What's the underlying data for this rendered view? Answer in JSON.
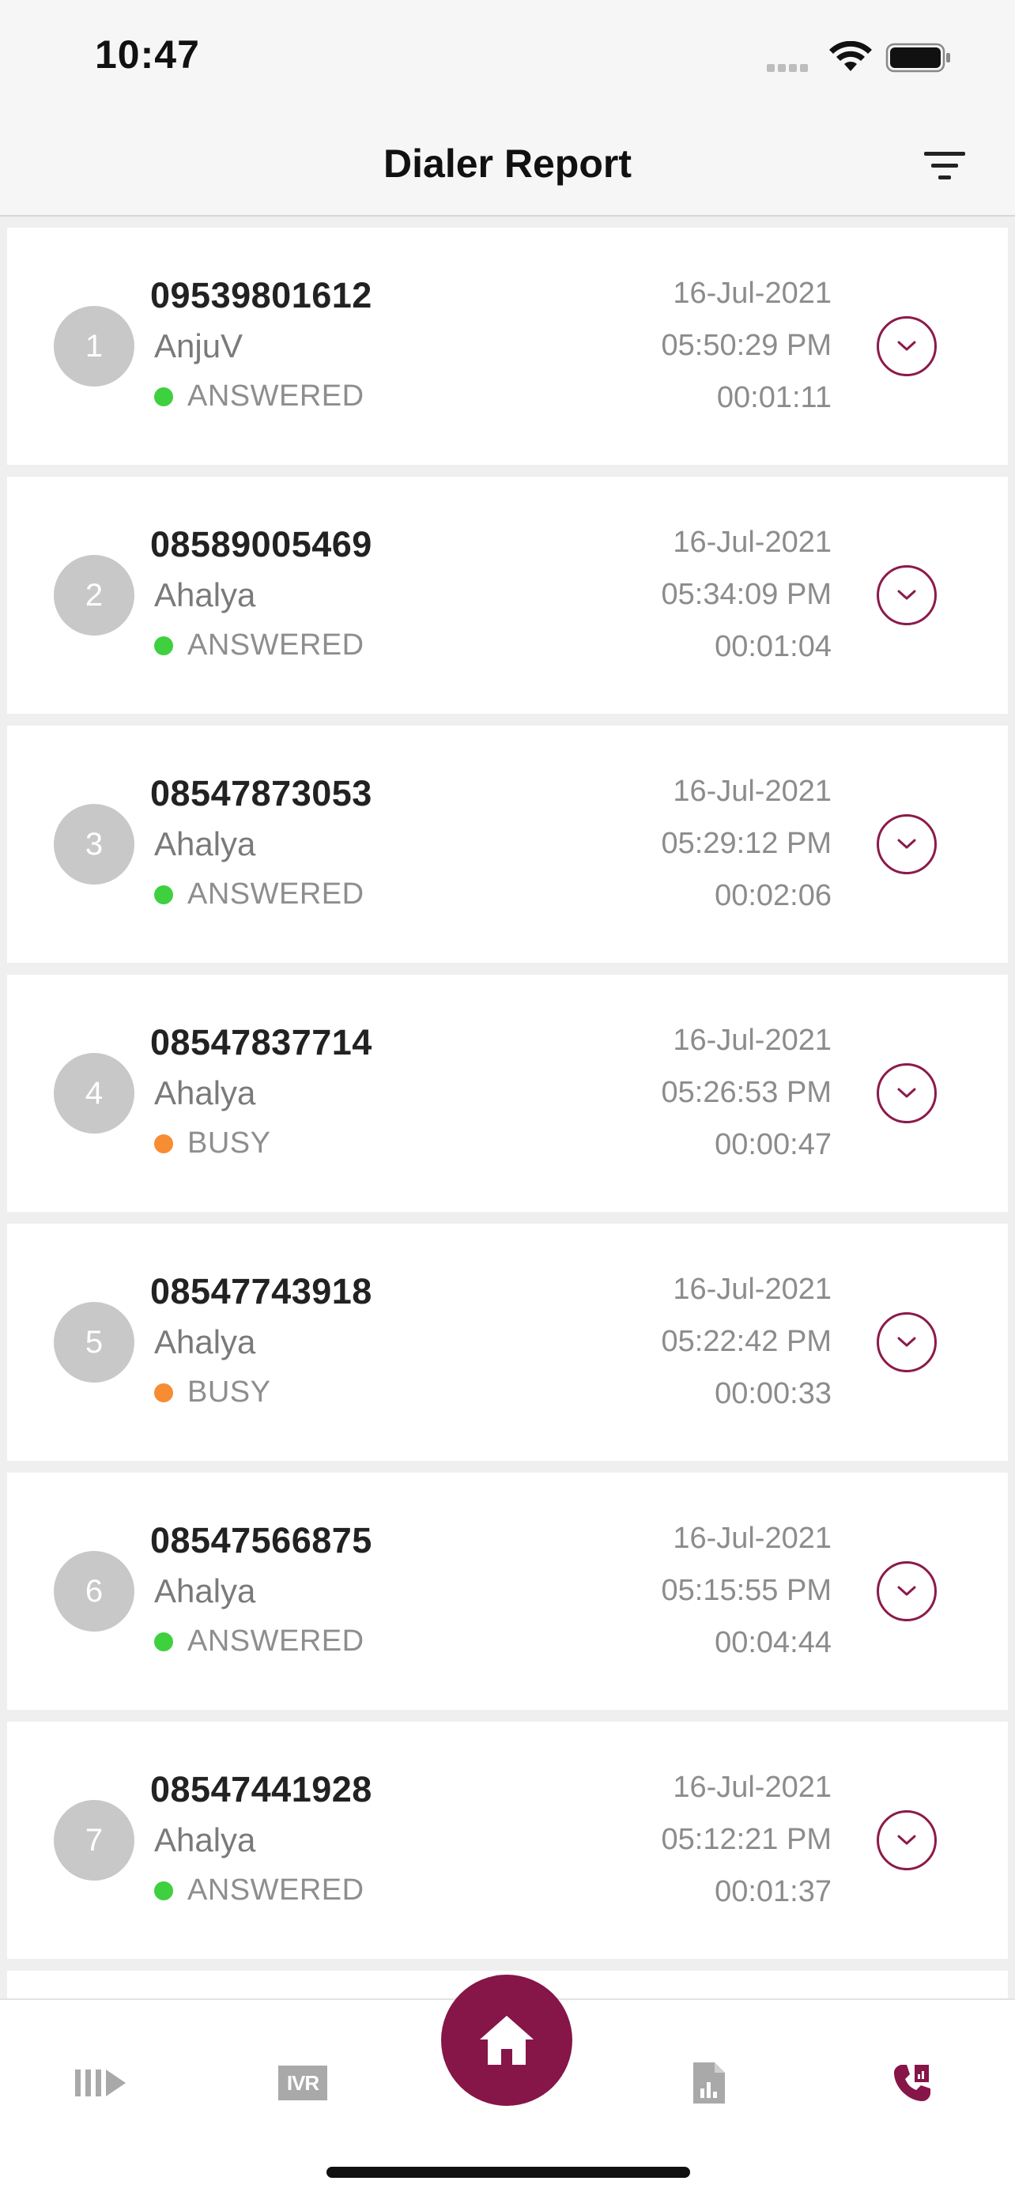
{
  "status_bar": {
    "time": "10:47"
  },
  "header": {
    "title": "Dialer Report"
  },
  "calls": [
    {
      "index": "1",
      "number": "09539801612",
      "agent": "AnjuV",
      "status": "ANSWERED",
      "status_color": "#3fd03f",
      "date": "16-Jul-2021",
      "time": "05:50:29 PM",
      "duration": "00:01:11"
    },
    {
      "index": "2",
      "number": "08589005469",
      "agent": "Ahalya",
      "status": "ANSWERED",
      "status_color": "#3fd03f",
      "date": "16-Jul-2021",
      "time": "05:34:09 PM",
      "duration": "00:01:04"
    },
    {
      "index": "3",
      "number": "08547873053",
      "agent": "Ahalya",
      "status": "ANSWERED",
      "status_color": "#3fd03f",
      "date": "16-Jul-2021",
      "time": "05:29:12 PM",
      "duration": "00:02:06"
    },
    {
      "index": "4",
      "number": "08547837714",
      "agent": "Ahalya",
      "status": "BUSY",
      "status_color": "#f78c32",
      "date": "16-Jul-2021",
      "time": "05:26:53 PM",
      "duration": "00:00:47"
    },
    {
      "index": "5",
      "number": "08547743918",
      "agent": "Ahalya",
      "status": "BUSY",
      "status_color": "#f78c32",
      "date": "16-Jul-2021",
      "time": "05:22:42 PM",
      "duration": "00:00:33"
    },
    {
      "index": "6",
      "number": "08547566875",
      "agent": "Ahalya",
      "status": "ANSWERED",
      "status_color": "#3fd03f",
      "date": "16-Jul-2021",
      "time": "05:15:55 PM",
      "duration": "00:04:44"
    },
    {
      "index": "7",
      "number": "08547441928",
      "agent": "Ahalya",
      "status": "ANSWERED",
      "status_color": "#3fd03f",
      "date": "16-Jul-2021",
      "time": "05:12:21 PM",
      "duration": "00:01:37"
    }
  ],
  "bottom_nav": {
    "ivr_label": "IVR",
    "items": [
      "campaign-icon",
      "ivr-icon",
      "home-icon",
      "report-icon",
      "dialer-report-icon"
    ],
    "active_item": "dialer-report-icon"
  },
  "colors": {
    "accent": "#861548",
    "answered": "#3fd03f",
    "busy": "#f78c32",
    "inactive_icon": "#a9a9a9"
  }
}
